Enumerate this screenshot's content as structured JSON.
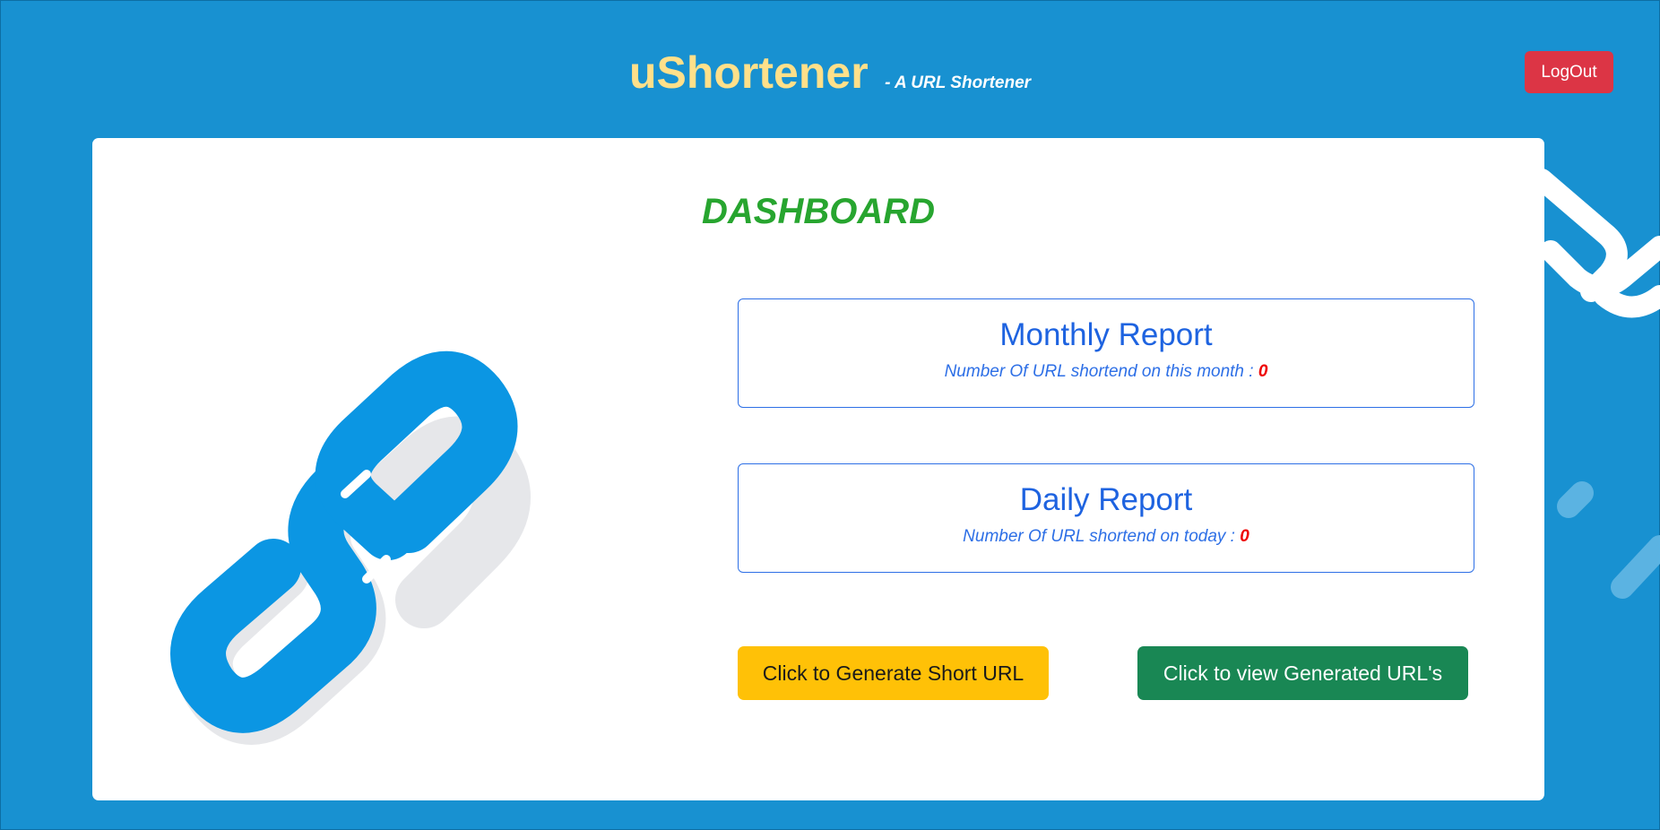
{
  "header": {
    "brand": "uShortener",
    "tagline": "- A URL Shortener",
    "logout_label": "LogOut"
  },
  "main": {
    "title": "DASHBOARD",
    "monthly_report": {
      "title": "Monthly Report",
      "label": "Number Of URL shortend on this month : ",
      "count": "0"
    },
    "daily_report": {
      "title": "Daily Report",
      "label": "Number Of URL shortend on today : ",
      "count": "0"
    },
    "actions": {
      "generate_label": "Click to Generate Short URL",
      "view_label": "Click to view Generated URL's"
    }
  },
  "icons": {
    "illustration": "link-chain-icon",
    "background": "link-chain-icon"
  },
  "colors": {
    "background": "#1891d1",
    "brand": "#ffe08a",
    "dashboard_title": "#27a52f",
    "report_accent": "#1e63e0",
    "count": "#ee0000",
    "logout": "#dc3545",
    "generate_button": "#ffc107",
    "view_button": "#198754",
    "chain": "#0b96e3"
  }
}
